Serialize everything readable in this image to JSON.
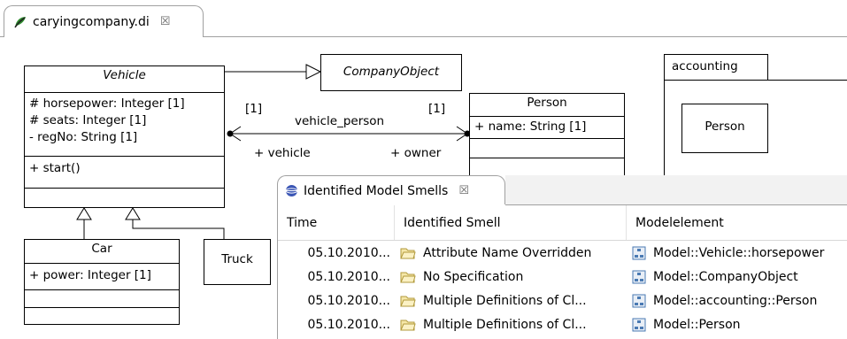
{
  "editor": {
    "tab_title": "caryingcompany.di",
    "close_glyph": "☒",
    "icon": "papyrus-leaf-icon"
  },
  "diagram": {
    "classes": {
      "vehicle": {
        "name": "Vehicle",
        "attributes": [
          "# horsepower: Integer [1]",
          "# seats: Integer [1]",
          "- regNo: String [1]"
        ],
        "operations": [
          "+ start()"
        ]
      },
      "company_object": {
        "name": "CompanyObject"
      },
      "person": {
        "name": "Person",
        "attributes": [
          "+ name: String [1]"
        ]
      },
      "car": {
        "name": "Car",
        "attributes": [
          "+ power: Integer [1]"
        ]
      },
      "truck": {
        "name": "Truck"
      }
    },
    "association": {
      "name": "vehicle_person",
      "left_multiplicity": "[1]",
      "right_multiplicity": "[1]",
      "left_role": "+ vehicle",
      "right_role": "+ owner"
    },
    "package": {
      "name": "accounting",
      "inner_class": "Person"
    }
  },
  "smells_view": {
    "title": "Identified Model Smells",
    "close_glyph": "☒",
    "columns": [
      "Time",
      "Identified Smell",
      "Modelelement"
    ],
    "rows": [
      {
        "time": "05.10.2010...",
        "smell": "Attribute Name Overridden",
        "element": "Model::Vehicle::horsepower"
      },
      {
        "time": "05.10.2010...",
        "smell": "No Specification",
        "element": "Model::CompanyObject"
      },
      {
        "time": "05.10.2010...",
        "smell": "Multiple Definitions of Cl...",
        "element": "Model::accounting::Person"
      },
      {
        "time": "05.10.2010...",
        "smell": "Multiple Definitions of Cl...",
        "element": "Model::Person"
      }
    ]
  },
  "colors": {
    "leaf_green": "#2e8b2e",
    "leaf_dark": "#1f1f1f",
    "folder_fill": "#f5e7a8",
    "folder_edge": "#b29a3b",
    "element_icon": "#4a7ab3",
    "view_icon": "#3b56b5"
  }
}
